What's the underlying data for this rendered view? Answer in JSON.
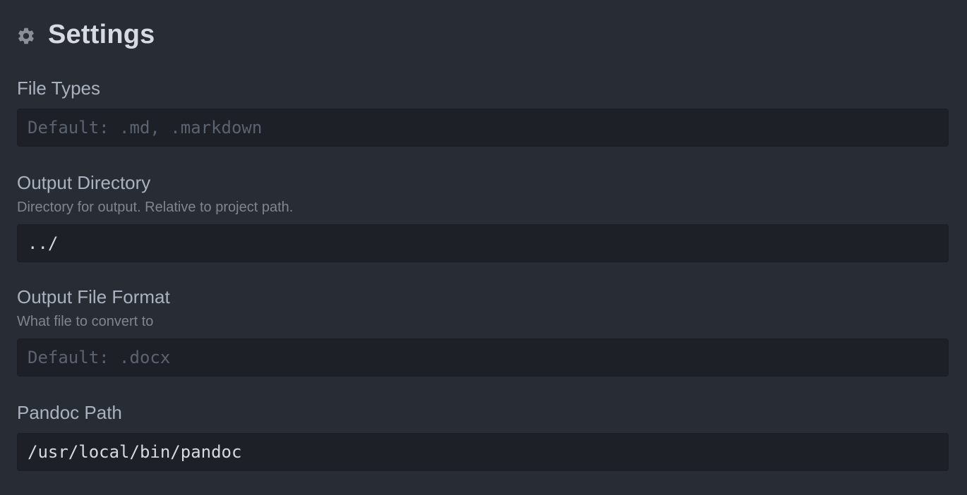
{
  "header": {
    "icon": "gear-icon",
    "title": "Settings"
  },
  "settings": [
    {
      "label": "File Types",
      "description": "",
      "value": "",
      "placeholder": "Default: .md, .markdown"
    },
    {
      "label": "Output Directory",
      "description": "Directory for output. Relative to project path.",
      "value": "../",
      "placeholder": ""
    },
    {
      "label": "Output File Format",
      "description": "What file to convert to",
      "value": "",
      "placeholder": "Default: .docx"
    },
    {
      "label": "Pandoc Path",
      "description": "",
      "value": "/usr/local/bin/pandoc",
      "placeholder": ""
    }
  ],
  "colors": {
    "background": "#282c34",
    "input_background": "#1d2027",
    "title": "#d7dae0",
    "label": "#abb2bf",
    "description": "#7f8591",
    "placeholder": "#5c6370"
  }
}
